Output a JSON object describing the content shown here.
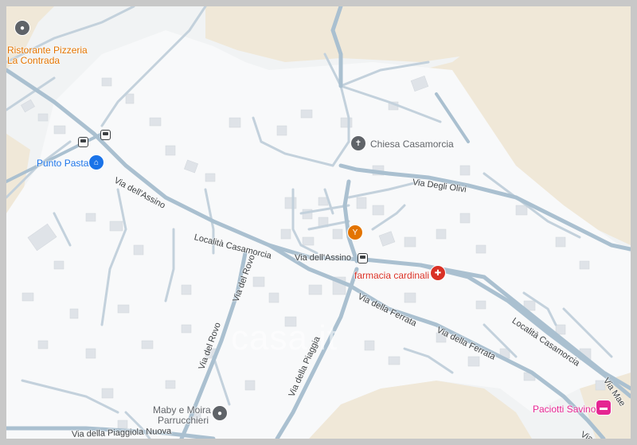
{
  "map": {
    "colors": {
      "background": "#f1f3f4",
      "land_beige": "#f0e8d8",
      "road": "#aac0d0",
      "building": "#dfe3e8"
    },
    "places": {
      "ristorante_line1": "Ristorante Pizzeria",
      "ristorante_line2": "La Contrada",
      "punto_pasta": "Punto Pasta",
      "chiesa": "Chiesa Casamorcia",
      "farmacia": "farmacia cardinali",
      "paciotti": "Paciotti Savino",
      "maby_line1": "Maby e Moira",
      "maby_line2": "Parrucchieri"
    },
    "roads": {
      "via_assino_left": "Via dell'Assino",
      "localita_casamorcia_left": "Località Casamorcia",
      "via_assino_center": "Via dell'Assino",
      "via_degli_olivi": "Via Degli Olivi",
      "via_del_rovo_1": "Via del Rovo",
      "via_del_rovo_2": "Via del Rovo",
      "via_della_ferrata_1": "Via della Ferrata",
      "via_della_ferrata_2": "Via della Ferrata",
      "via_della_piaggia": "Via della Piaggia",
      "localita_casamorcia_right": "Località Casamorcia",
      "via_mae": "Via Mae",
      "via_piaggiola": "Via della Piaggiola Nuova",
      "via_bottom_right": "Via"
    },
    "watermark": "casa.it",
    "icons": {
      "ristorante": "place-icon",
      "punto_pasta": "shopping-bag-icon",
      "chiesa": "church-icon",
      "bar": "cocktail-icon",
      "farmacia": "pharmacy-icon",
      "paciotti": "bed-icon",
      "maby": "place-icon",
      "bus": "bus-stop-icon"
    }
  }
}
